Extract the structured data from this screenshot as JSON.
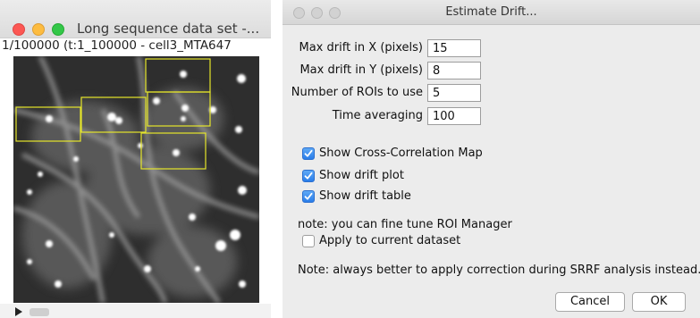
{
  "image_window": {
    "title": "Long sequence data set -...",
    "subtitle": "1/100000 (t:1_100000 - cell3_MTA647"
  },
  "dialog": {
    "title": "Estimate Drift...",
    "fields": [
      {
        "label": "Max drift in X (pixels)",
        "value": "15"
      },
      {
        "label": "Max drift in Y (pixels)",
        "value": "8"
      },
      {
        "label": "Number of ROIs to use",
        "value": "5"
      },
      {
        "label": "Time averaging",
        "value": "100"
      }
    ],
    "checkboxes": [
      {
        "label": "Show Cross-Correlation Map",
        "checked": true
      },
      {
        "label": "Show drift plot",
        "checked": true
      },
      {
        "label": "Show drift table",
        "checked": true
      }
    ],
    "note1": "note: you can fine tune ROI Manager",
    "apply_checkbox": {
      "label": "Apply to current dataset",
      "checked": false
    },
    "note2": "Note: always better to apply correction during SRRF analysis instead.",
    "cancel_label": "Cancel",
    "ok_label": "OK"
  },
  "colors": {
    "roi_outline": "#e6e62a",
    "checkbox_accent": "#2a7de9"
  }
}
